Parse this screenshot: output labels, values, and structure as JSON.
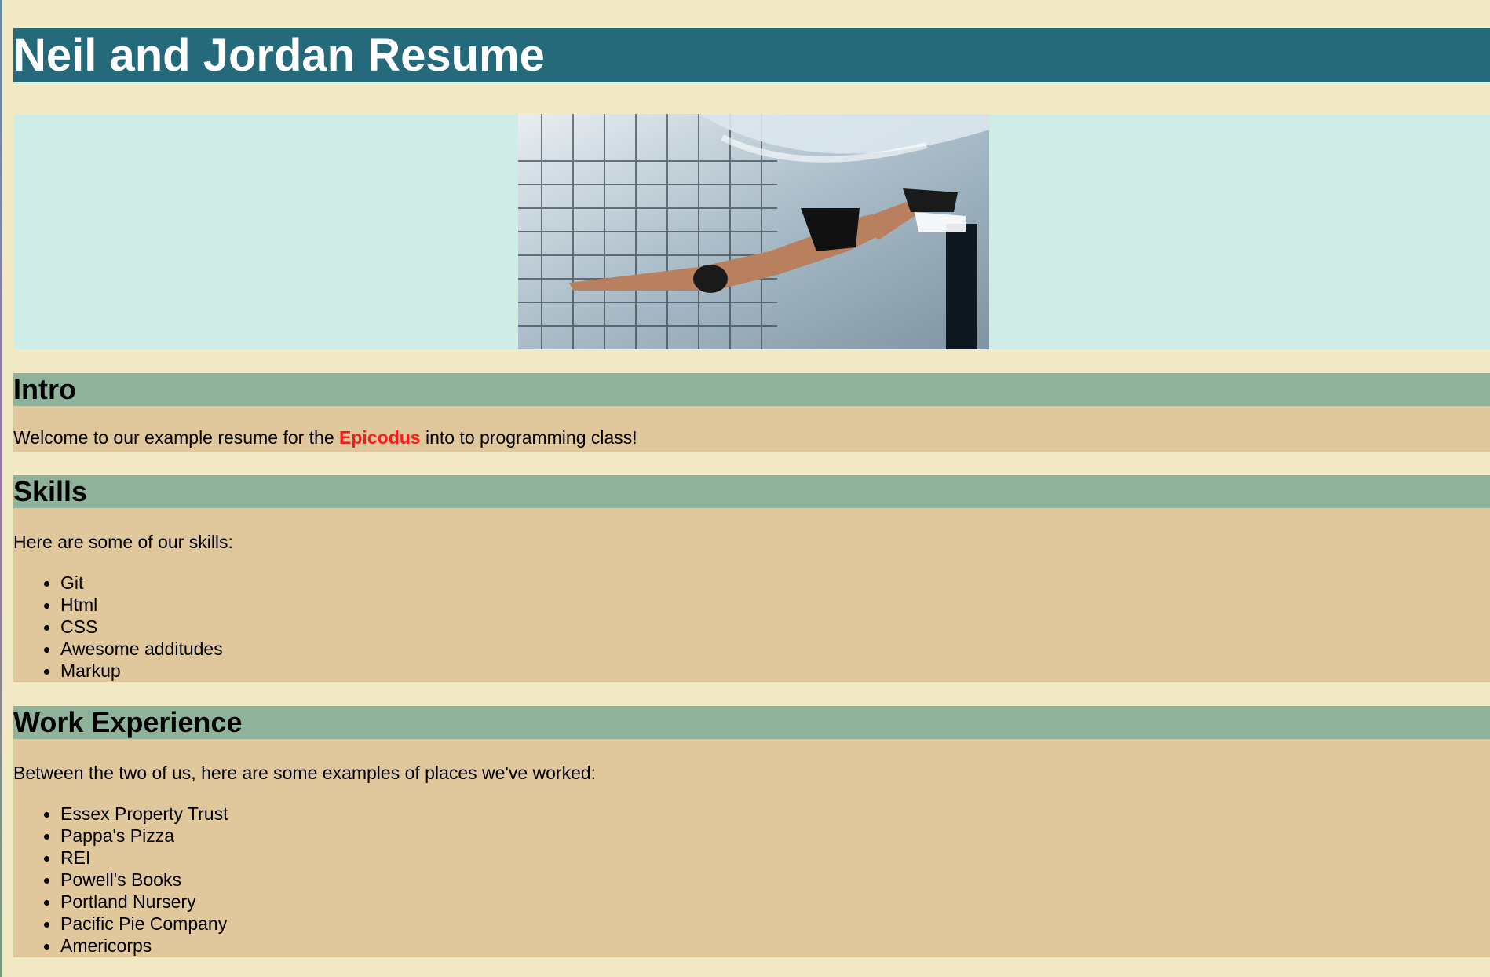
{
  "header": {
    "title": "Neil and Jordan Resume"
  },
  "hero": {
    "image_alt": "Underwater swimmer"
  },
  "intro": {
    "heading": "Intro",
    "text_before": "Welcome to our example resume for the ",
    "highlight": "Epicodus",
    "text_after": " into to programming class!"
  },
  "skills": {
    "heading": "Skills",
    "lead": "Here are some of our skills:",
    "items": [
      "Git",
      "Html",
      "CSS",
      "Awesome additudes",
      "Markup"
    ]
  },
  "work": {
    "heading": "Work Experience",
    "lead": "Between the two of us, here are some examples of places we've worked:",
    "items": [
      "Essex Property Trust",
      "Pappa's Pizza",
      "REI",
      "Powell's Books",
      "Portland Nursery",
      "Pacific Pie Company",
      "Americorps"
    ]
  },
  "colors": {
    "page_background": "#f2eac4",
    "title_bar": "#256a7a",
    "hero_background": "#cfede6",
    "section_heading": "#8fb39a",
    "section_body": "#e0c89c",
    "highlight_text": "#ff1a1a"
  }
}
